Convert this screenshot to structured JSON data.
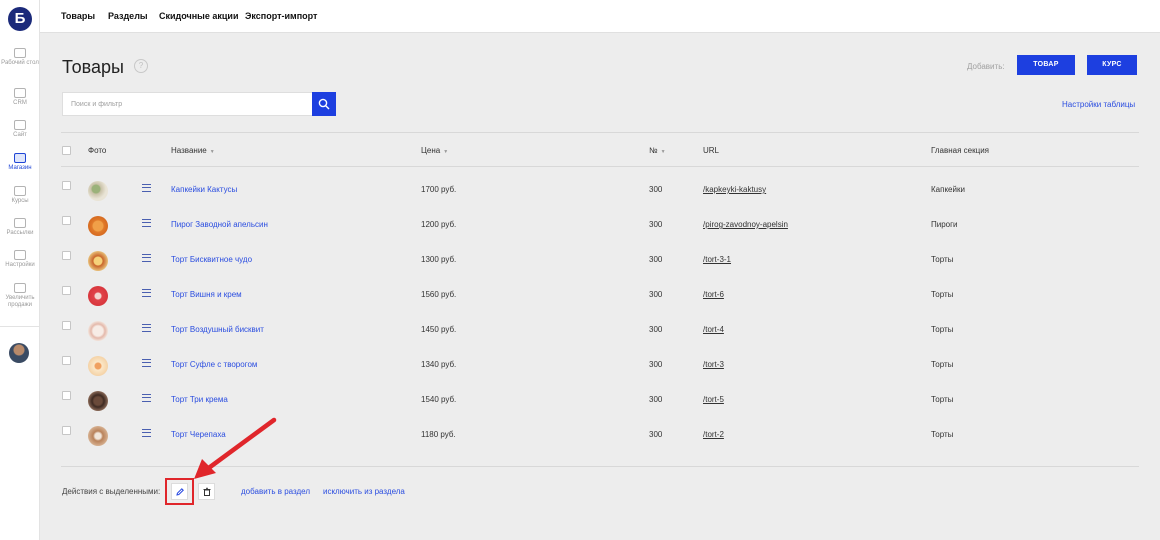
{
  "sidebar": {
    "logo": "Б",
    "items": [
      {
        "label": "Рабочий стол",
        "icon": "monitor-icon",
        "active": false
      },
      {
        "label": "CRM",
        "icon": "funnel-icon",
        "active": false
      },
      {
        "label": "Сайт",
        "icon": "pages-icon",
        "active": false
      },
      {
        "label": "Магазин",
        "icon": "shop-icon",
        "active": true
      },
      {
        "label": "Курсы",
        "icon": "books-icon",
        "active": false
      },
      {
        "label": "Рассылки",
        "icon": "mail-icon",
        "active": false
      },
      {
        "label": "Настройки",
        "icon": "sliders-icon",
        "active": false
      },
      {
        "label": "Увеличить продажи",
        "icon": "hand-icon",
        "active": false
      }
    ]
  },
  "topnav": [
    "Товары",
    "Разделы",
    "Скидочные акции",
    "Экспорт-импорт"
  ],
  "page": {
    "title": "Товары",
    "help": "?",
    "add_label": "Добавить:",
    "btn_product": "ТОВАР",
    "btn_course": "КУРС",
    "search_placeholder": "Поиск и фильтр",
    "table_settings": "Настройки таблицы"
  },
  "table": {
    "headers": {
      "photo": "Фото",
      "name": "Название",
      "price": "Цена",
      "number": "№",
      "url": "URL",
      "section": "Главная секция"
    },
    "sort_glyph": "▼",
    "rows": [
      {
        "name": "Капкейки Кактусы",
        "price": "1700 руб.",
        "number": "300",
        "url": "/kapkeyki-kaktusy",
        "section": "Капкейки"
      },
      {
        "name": "Пирог Заводной апельсин",
        "price": "1200 руб.",
        "number": "300",
        "url": "/pirog-zavodnoy-apelsin",
        "section": "Пироги"
      },
      {
        "name": "Торт Бисквитное чудо",
        "price": "1300 руб.",
        "number": "300",
        "url": "/tort-3-1",
        "section": "Торты"
      },
      {
        "name": "Торт Вишня и крем",
        "price": "1560 руб.",
        "number": "300",
        "url": "/tort-6",
        "section": "Торты"
      },
      {
        "name": "Торт Воздушный бисквит",
        "price": "1450 руб.",
        "number": "300",
        "url": "/tort-4",
        "section": "Торты"
      },
      {
        "name": "Торт Суфле с творогом",
        "price": "1340 руб.",
        "number": "300",
        "url": "/tort-3",
        "section": "Торты"
      },
      {
        "name": "Торт Три крема",
        "price": "1540 руб.",
        "number": "300",
        "url": "/tort-5",
        "section": "Торты"
      },
      {
        "name": "Торт Черепаха",
        "price": "1180 руб.",
        "number": "300",
        "url": "/tort-2",
        "section": "Торты"
      }
    ]
  },
  "actions": {
    "label": "Действия с выделенными:",
    "edit_icon": "pencil-icon",
    "delete_icon": "trash-icon",
    "add_to_section": "добавить в раздел",
    "remove_from_section": "исключить из раздела"
  },
  "colors": {
    "accent": "#1d3fe0",
    "link": "#2a4de0",
    "highlight": "#e0262b"
  }
}
